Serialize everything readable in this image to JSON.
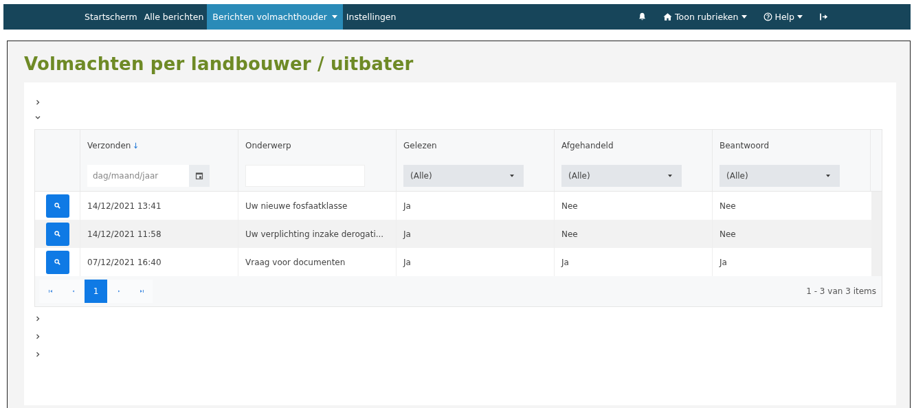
{
  "nav": {
    "items": [
      {
        "label": "Startscherm",
        "selected": false,
        "dropdown": false
      },
      {
        "label": "Alle berichten",
        "selected": false,
        "dropdown": false
      },
      {
        "label": "Berichten volmachthouder",
        "selected": true,
        "dropdown": true
      },
      {
        "label": "Instellingen",
        "selected": false,
        "dropdown": false
      }
    ],
    "right_items": [
      {
        "kind": "bell"
      },
      {
        "kind": "home",
        "label": "Toon rubrieken",
        "dropdown": true
      },
      {
        "kind": "help",
        "label": "Help",
        "dropdown": true
      },
      {
        "kind": "logout"
      }
    ]
  },
  "page": {
    "title": "Volmachten per landbouwer / uitbater"
  },
  "sections_before": [
    {
      "expanded": false
    },
    {
      "expanded": true
    }
  ],
  "table": {
    "columns": [
      {
        "label": "Verzonden",
        "sorted": true,
        "filter": {
          "kind": "date",
          "placeholder": "dag/maand/jaar"
        }
      },
      {
        "label": "Onderwerp",
        "sorted": false,
        "filter": {
          "kind": "text"
        }
      },
      {
        "label": "Gelezen",
        "sorted": false,
        "filter": {
          "kind": "select",
          "value": "(Alle)"
        }
      },
      {
        "label": "Afgehandeld",
        "sorted": false,
        "filter": {
          "kind": "select",
          "value": "(Alle)"
        }
      },
      {
        "label": "Beantwoord",
        "sorted": false,
        "filter": {
          "kind": "select",
          "value": "(Alle)"
        }
      }
    ],
    "rows": [
      {
        "cells": [
          "14/12/2021 13:41",
          "Uw nieuwe fosfaatklasse",
          "Ja",
          "Nee",
          "Nee"
        ]
      },
      {
        "cells": [
          "14/12/2021 11:58",
          "Uw verplichting inzake derogati...",
          "Ja",
          "Nee",
          "Nee"
        ]
      },
      {
        "cells": [
          "07/12/2021 16:40",
          "Vraag voor documenten",
          "Ja",
          "Ja",
          "Ja"
        ]
      }
    ],
    "pager": {
      "pages": [
        {
          "label": "1",
          "selected": true
        }
      ],
      "summary": "1 - 3 van 3 items"
    }
  },
  "sections_after": [
    {
      "expanded": false
    },
    {
      "expanded": false
    },
    {
      "expanded": false
    }
  ]
}
